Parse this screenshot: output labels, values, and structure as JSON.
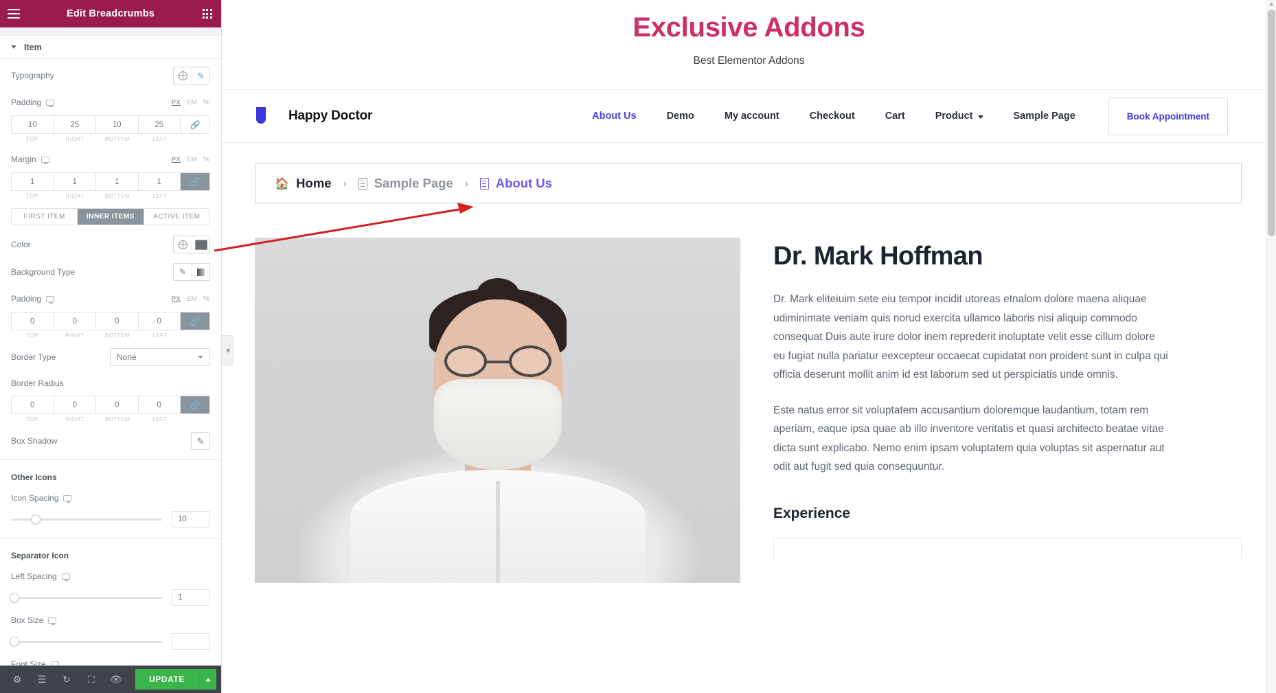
{
  "panel": {
    "title": "Edit Breadcrumbs",
    "menu_icon": "hamburger-icon",
    "apps_icon": "grid-apps-icon",
    "section": {
      "label": "Item"
    },
    "controls": {
      "typography": {
        "label": "Typography",
        "globe_icon": "globe-icon",
        "edit_icon": "pencil-icon"
      },
      "padding_item": {
        "label": "Padding",
        "units": [
          "PX",
          "EM",
          "%"
        ],
        "active_unit": "PX",
        "values": [
          "10",
          "25",
          "10",
          "25"
        ],
        "legend": [
          "TOP",
          "RIGHT",
          "BOTTOM",
          "LEFT"
        ],
        "link_icon": "link-icon",
        "linked": false
      },
      "margin_item": {
        "label": "Margin",
        "units": [
          "PX",
          "EM",
          "%"
        ],
        "active_unit": "PX",
        "values": [
          "1",
          "1",
          "1",
          "1"
        ],
        "legend": [
          "TOP",
          "RIGHT",
          "BOTTOM",
          "LEFT"
        ],
        "link_icon": "link-icon",
        "linked": true
      },
      "tabs": {
        "items": [
          "FIRST ITEM",
          "INNER ITEMS",
          "ACTIVE ITEM"
        ],
        "active": "INNER ITEMS"
      },
      "color": {
        "label": "Color",
        "globe_icon": "globe-icon",
        "swatch_icon": "color-swatch",
        "swatch_color": "#696f74"
      },
      "background_type": {
        "label": "Background Type",
        "classic_icon": "brush-icon",
        "gradient_icon": "gradient-icon"
      },
      "padding_inner": {
        "label": "Padding",
        "units": [
          "PX",
          "EM",
          "%"
        ],
        "active_unit": "PX",
        "values": [
          "0",
          "0",
          "0",
          "0"
        ],
        "legend": [
          "TOP",
          "RIGHT",
          "BOTTOM",
          "LEFT"
        ],
        "link_icon": "link-icon",
        "linked": true
      },
      "border_type": {
        "label": "Border Type",
        "value": "None"
      },
      "border_radius": {
        "label": "Border Radius",
        "values": [
          "0",
          "0",
          "0",
          "0"
        ],
        "legend": [
          "TOP",
          "RIGHT",
          "BOTTOM",
          "LEFT"
        ],
        "link_icon": "link-icon",
        "linked": true
      },
      "box_shadow": {
        "label": "Box Shadow",
        "edit_icon": "pencil-icon"
      },
      "other_icons_group": {
        "label": "Other Icons"
      },
      "icon_spacing": {
        "label": "Icon Spacing",
        "value": "10",
        "slider_pct": 19
      },
      "separator_icon_group": {
        "label": "Separator Icon"
      },
      "left_spacing": {
        "label": "Left Spacing",
        "value": "1",
        "slider_pct": 0
      },
      "box_size": {
        "label": "Box Size",
        "value": "",
        "slider_pct": 0
      },
      "font_size": {
        "label": "Font Size",
        "value": ""
      }
    },
    "footer": {
      "icons": [
        "gear-icon",
        "layers-icon",
        "history-icon",
        "responsive-icon",
        "eye-icon"
      ],
      "update_label": "UPDATE",
      "caret_icon": "caret-up-icon"
    },
    "collapse_icon": "chevron-left-icon"
  },
  "preview": {
    "hero": {
      "title": "Exclusive Addons",
      "subtitle": "Best Elementor Addons"
    },
    "header": {
      "logo_icon": "happy-doctor-logo",
      "brand": "Happy Doctor",
      "nav": [
        {
          "label": "About Us",
          "active": true,
          "has_dropdown": false
        },
        {
          "label": "Demo",
          "active": false,
          "has_dropdown": false
        },
        {
          "label": "My account",
          "active": false,
          "has_dropdown": false
        },
        {
          "label": "Checkout",
          "active": false,
          "has_dropdown": false
        },
        {
          "label": "Cart",
          "active": false,
          "has_dropdown": false
        },
        {
          "label": "Product",
          "active": false,
          "has_dropdown": true
        },
        {
          "label": "Sample Page",
          "active": false,
          "has_dropdown": false
        }
      ],
      "cta": "Book Appointment"
    },
    "breadcrumbs": {
      "separator": "›",
      "items": [
        {
          "label": "Home",
          "icon": "home-icon",
          "state": "home"
        },
        {
          "label": "Sample Page",
          "icon": "document-icon",
          "state": "mid"
        },
        {
          "label": "About Us",
          "icon": "document-icon",
          "state": "active"
        }
      ]
    },
    "doctor": {
      "photo_alt": "doctor-portrait",
      "name": "Dr. Mark Hoffman",
      "paragraph1": "Dr. Mark eliteiuim sete eiu tempor incidit utoreas etnalom dolore maena aliquae udiminimate veniam quis norud exercita ullamco laboris nisi aliquip commodo consequat Duis aute irure dolor inem reprederit inoluptate velit esse cillum dolore eu fugiat nulla pariatur eexcepteur occaecat cupidatat non proident sunt in culpa qui officia deserunt mollit anim id est laborum sed ut perspiciatis unde omnis.",
      "paragraph2": "Este natus error sit voluptatem accusantium doloremque laudantium, totam rem aperiam, eaque ipsa quae ab illo inventore veritatis et quasi architecto beatae vitae dicta sunt explicabo. Nemo enim ipsam voluptatem quia voluptas sit aspernatur aut odit aut fugit sed quia consequuntur.",
      "experience_title": "Experience"
    }
  },
  "annotation": {
    "arrow_icon": "red-arrow-pointer",
    "color": "#d32020"
  },
  "colors": {
    "panel_header": "#9b1b4b",
    "update_green": "#39b54a",
    "hero_pink": "#cf2e60",
    "accent_blue": "#3b37e0",
    "crumb_active": "#6b5ce7"
  }
}
